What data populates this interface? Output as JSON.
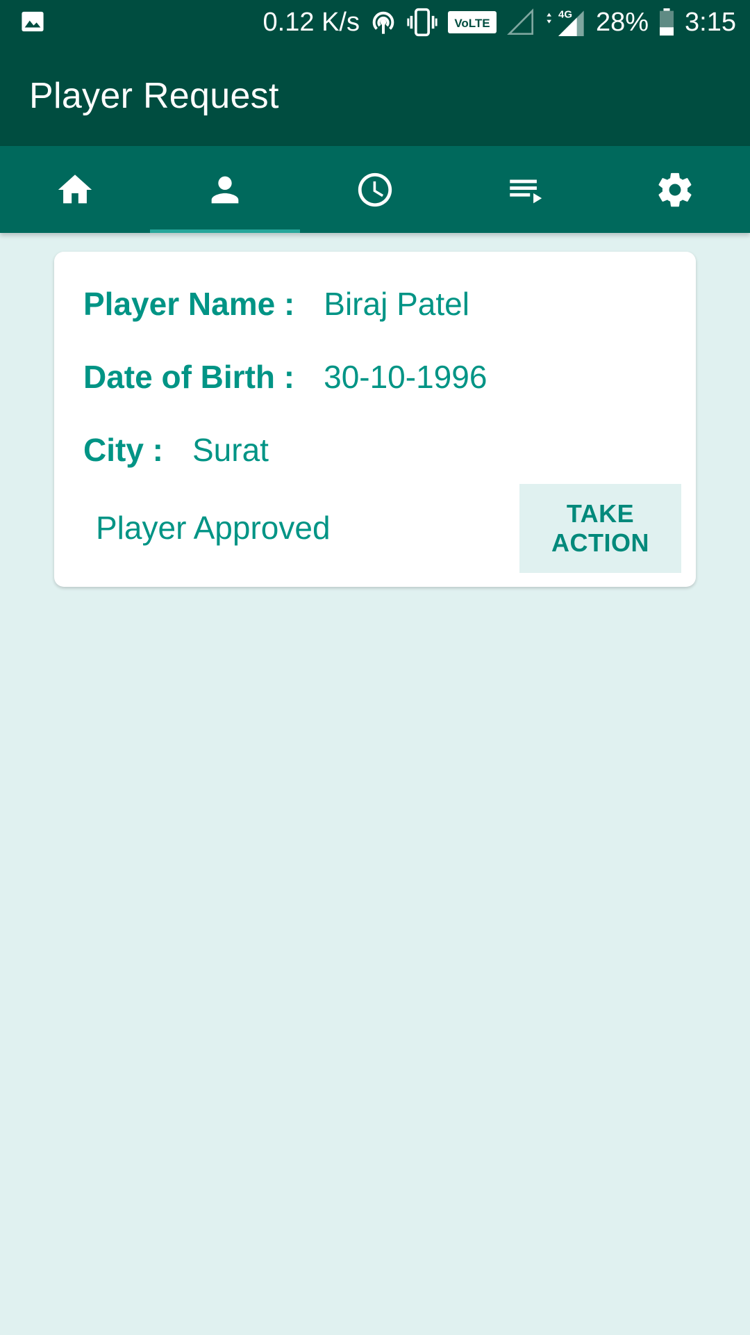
{
  "status_bar": {
    "net_speed": "0.12 K/s",
    "volte": "VoLTE",
    "network": "4G",
    "battery": "28%",
    "time": "3:15",
    "icons": [
      "gallery-icon",
      "hotspot-icon",
      "vibrate-icon",
      "volte-icon",
      "no-signal-icon",
      "4g-signal-icon",
      "battery-icon"
    ]
  },
  "app_bar": {
    "title": "Player Request"
  },
  "tabs": [
    {
      "icon": "home-icon",
      "active": false
    },
    {
      "icon": "person-icon",
      "active": true
    },
    {
      "icon": "clock-icon",
      "active": false
    },
    {
      "icon": "playlist-icon",
      "active": false
    },
    {
      "icon": "gear-icon",
      "active": false
    }
  ],
  "card": {
    "player_name_label": "Player Name :",
    "player_name": "Biraj Patel",
    "dob_label": "Date of Birth :",
    "dob": "30-10-1996",
    "city_label": "City :",
    "city": "Surat",
    "status": "Player Approved",
    "action_label": "TAKE ACTION"
  },
  "colors": {
    "primary_dark": "#004d40",
    "primary": "#00695c",
    "accent": "#009485",
    "background": "#e0f1f0"
  }
}
